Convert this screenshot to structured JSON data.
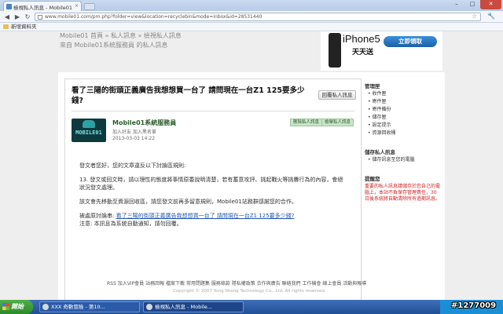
{
  "browser": {
    "tab_title": "檢視私人訊息 - Mobile01",
    "tab_close": "×",
    "url": "www.mobile01.com/pm.php?folder=view&location=recyclebin&mode=inbox&id=28531440",
    "bookmarks": [
      "新增資料夾"
    ],
    "win_min": "–",
    "win_max": "□",
    "win_close": "✕",
    "back": "◀",
    "forward": "▶",
    "reload": "↻",
    "star": "☆",
    "wrench": "🔧"
  },
  "page": {
    "breadcrumb": "Mobile01 首頁 » 私人訊息 » 檢視私人訊息",
    "from_line": "來自 Mobile01系統服務員 的私人訊息",
    "ad": {
      "title": "iPhone5",
      "subtitle": "天天送",
      "cta": "立即領取"
    },
    "message": {
      "subject": "看了三陽的街頭正義廣告我想想買一台了 請問現在一台Z1 125要多少錢?",
      "reply_button": "回覆私人訊息",
      "avatar_text": "MOBILE01",
      "sender": "Mobile01系統服務員",
      "sender_actions": "加入好友  加入黑名單",
      "date": "2013-03-03 14:22",
      "tags": [
        "刪除私人訊息",
        "檢舉私人訊息"
      ],
      "body": [
        "發文者您好，您的文章違反以下討論區規則:",
        "13. 發文或回文時，請以理性的態度將事情原委說明清楚，若有蓄意攻評、挑起戰火等挑釁行為的內容，會絕狀況發文處理。",
        "該文會先移動至資源回收區，請您發文前再多留意規則，Mobile01站務群感謝您的合作。",
        "被處原討論串: ",
        "注意: 本訊息為系統自動通知，請勿回覆。"
      ],
      "thread_link": "看了三陽的街頭正義廣告我想想買一台了 請問現在一台Z1 125要多少錢?"
    },
    "sidebar": {
      "section1_title": "管理匣",
      "section1_items": [
        "收件匣",
        "寄件匣",
        "寄件備份",
        "儲存匣",
        "設定提示",
        "資源回收桶"
      ],
      "section2_title": "儲存私人訊息",
      "section2_items": [
        "儲存訊息至您的電腦"
      ],
      "section3_title": "提醒您",
      "section3_text": "重要的私人訊息請儲存於您自己的電腦上，本站不負保存管理責任，30日後系統將自動清除所有過期訊息。"
    },
    "footer": {
      "links": "RSS  加入VIP會員  站務回報  檔案下載  常用問題集  服務條款  隱私權政策  合作與廣告  聯絡我們  工作機會  線上會員  活動與報導",
      "copyright": "Copyright © 2007 Yong Sheng Technology Co., Ltd. All rights reserved."
    }
  },
  "taskbar": {
    "start": "開始",
    "tasks": [
      "XXX 奇數冒險 - 第10...",
      "檢視私人訊息 - Mobile..."
    ],
    "watermark": "#1277009"
  }
}
